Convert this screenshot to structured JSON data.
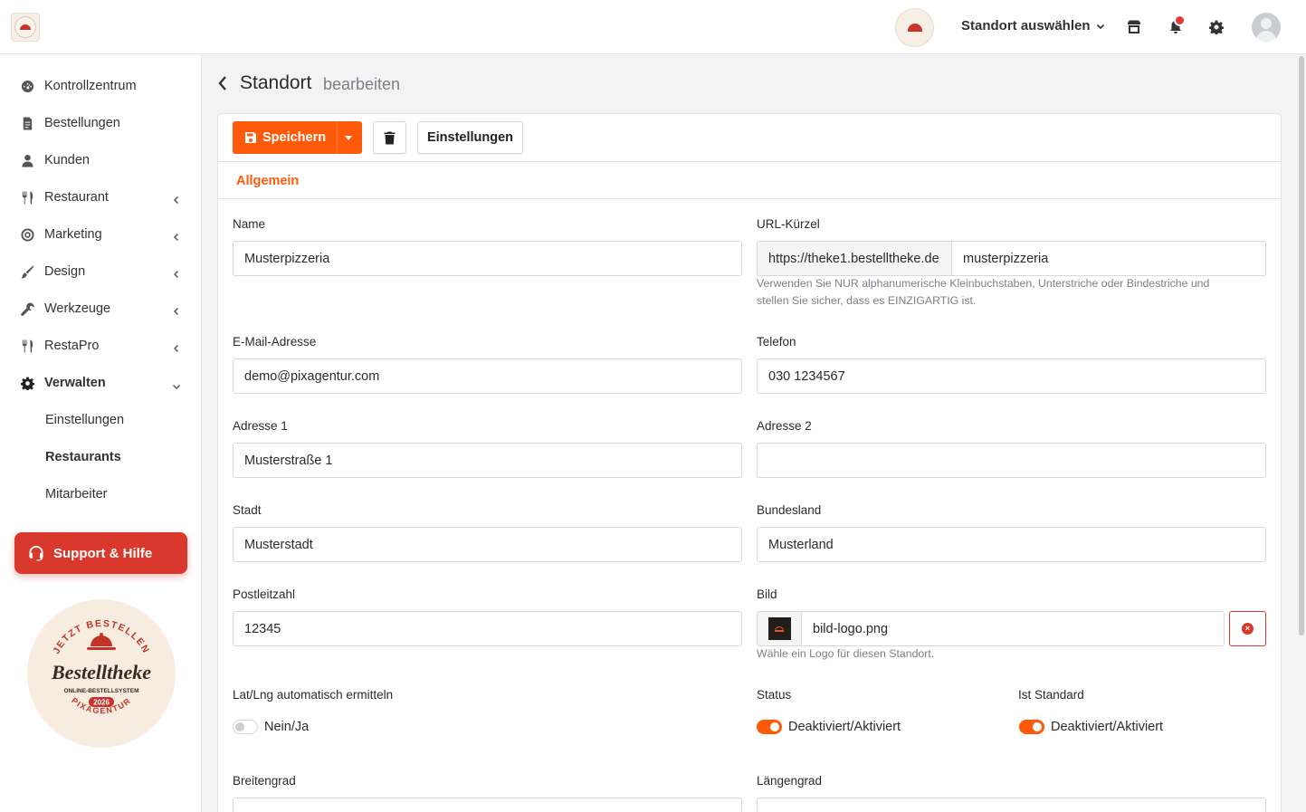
{
  "header": {
    "location_selector": "Standort auswählen"
  },
  "sidebar": {
    "items": [
      {
        "label": "Kontrollzentrum",
        "icon": "gauge-icon"
      },
      {
        "label": "Bestellungen",
        "icon": "receipt-icon"
      },
      {
        "label": "Kunden",
        "icon": "user-icon"
      },
      {
        "label": "Restaurant",
        "icon": "utensils-icon"
      },
      {
        "label": "Marketing",
        "icon": "target-icon"
      },
      {
        "label": "Design",
        "icon": "brush-icon"
      },
      {
        "label": "Werkzeuge",
        "icon": "wrench-icon"
      },
      {
        "label": "RestaPro",
        "icon": "utensils-icon"
      },
      {
        "label": "Verwalten",
        "icon": "gear-icon"
      }
    ],
    "subitems": [
      "Einstellungen",
      "Restaurants",
      "Mitarbeiter"
    ],
    "support_label": "Support & Hilfe"
  },
  "badge": {
    "top_text": "JETZT BESTELLEN",
    "brand": "Bestelltheke",
    "tagline": "ONLINE-BESTELLSYSTEM",
    "year": "2026",
    "bottom_text": "PIXAGENTUR"
  },
  "page": {
    "title": "Standort",
    "subtitle": "bearbeiten"
  },
  "toolbar": {
    "save_label": "Speichern",
    "settings_label": "Einstellungen"
  },
  "tabs": {
    "general": "Allgemein"
  },
  "form": {
    "name": {
      "label": "Name",
      "value": "Musterpizzeria"
    },
    "url": {
      "label": "URL-Kürzel",
      "prefix": "https://theke1.bestelltheke.de",
      "value": "musterpizzeria",
      "help_line1": "Verwenden Sie NUR alphanumerische Kleinbuchstaben, Unterstriche oder Bindestriche und",
      "help_line2": "stellen Sie sicher, dass es EINZIGARTIG ist."
    },
    "email": {
      "label": "E-Mail-Adresse",
      "value": "demo@pixagentur.com"
    },
    "phone": {
      "label": "Telefon",
      "value": "030 1234567"
    },
    "address1": {
      "label": "Adresse 1",
      "value": "Musterstraße 1"
    },
    "address2": {
      "label": "Adresse 2",
      "value": ""
    },
    "city": {
      "label": "Stadt",
      "value": "Musterstadt"
    },
    "state": {
      "label": "Bundesland",
      "value": "Musterland"
    },
    "zip": {
      "label": "Postleitzahl",
      "value": "12345"
    },
    "image": {
      "label": "Bild",
      "value": "bild-logo.png",
      "help": "Wähle ein Logo für diesen Standort."
    },
    "latlng_auto": {
      "label": "Lat/Lng automatisch ermitteln",
      "toggle_label": "Nein/Ja",
      "on": false
    },
    "status": {
      "label": "Status",
      "toggle_label": "Deaktiviert/Aktiviert",
      "on": true
    },
    "is_default": {
      "label": "Ist Standard",
      "toggle_label": "Deaktiviert/Aktiviert",
      "on": true
    },
    "latitude": {
      "label": "Breitengrad"
    },
    "longitude": {
      "label": "Längengrad"
    }
  },
  "colors": {
    "accent": "#ff5a0a",
    "support": "#d8392c"
  }
}
